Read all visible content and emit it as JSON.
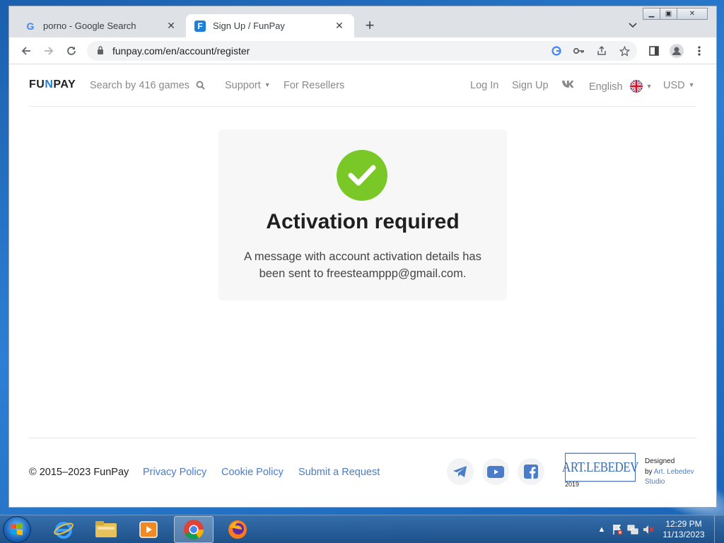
{
  "browser": {
    "tabs": [
      {
        "title": "porno - Google Search",
        "favicon": "G"
      },
      {
        "title": "Sign Up / FunPay",
        "favicon": "F"
      }
    ],
    "new_tab": "+",
    "url": "funpay.com/en/account/register"
  },
  "site": {
    "logo_left": "FU",
    "logo_accent": "N",
    "logo_right": "PAY",
    "search_placeholder": "Search by 416 games",
    "support": "Support",
    "resellers": "For Resellers",
    "login": "Log In",
    "signup": "Sign Up",
    "vk": "VK",
    "language": "English",
    "currency": "USD"
  },
  "card": {
    "title": "Activation required",
    "message": "A message with account activation details has been sent to freesteamppp@gmail.com."
  },
  "footer": {
    "copyright": "© 2015–2023 FunPay",
    "privacy": "Privacy Policy",
    "cookie": "Cookie Policy",
    "request": "Submit a Request",
    "lebedev_logo": "ART.LEBEDEV",
    "lebedev_year": "2019",
    "designed": "Designed",
    "by": "by",
    "studio_link": "Art. Lebedev Studio"
  },
  "taskbar": {
    "time": "12:29 PM",
    "date": "11/13/2023"
  },
  "colors": {
    "brand": "#1e7fd8",
    "success": "#7ac728",
    "link": "#4a7cc9"
  }
}
